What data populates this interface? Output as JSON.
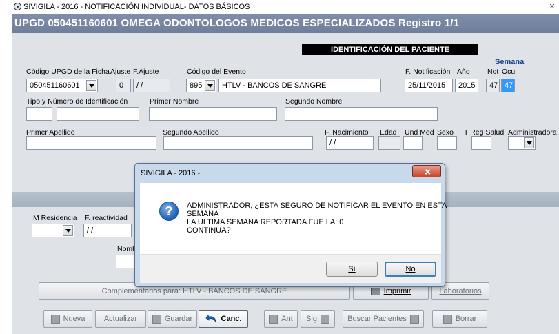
{
  "window": {
    "title": "SIVIGILA - 2016 -  NOTIFICACIÓN INDIVIDUAL- DATOS BÁSICOS",
    "close_label": "✕"
  },
  "header": {
    "upgd_text": "UPGD 050451160601 OMEGA ODONTOLOGOS MEDICOS ESPECIALIZADOS Registro 1/1",
    "section_title": "IDENTIFICACIÓN DEL PACIENTE"
  },
  "form": {
    "codigo_upgd_label": "Código UPGD de la Ficha",
    "codigo_upgd_value": "050451160601",
    "ajuste_label": "Ajuste",
    "ajuste_value": "0",
    "f_ajuste_label": "F.Ajuste",
    "f_ajuste_value": "/ /",
    "codigo_evento_label": "Código del Evento",
    "codigo_evento_value": "895",
    "evento_name": "HTLV - BANCOS DE SANGRE",
    "f_notificacion_label": "F. Notificación",
    "f_notificacion_value": "25/11/2015",
    "anio_label": "Año",
    "anio_value": "2015",
    "semana_label": "Semana",
    "not_label": "Not",
    "ocu_label": "Ocu",
    "semana_not_value": "47",
    "semana_ocu_value": "47",
    "tipo_id_label": "Tipo y Número de Identificación",
    "primer_nombre_label": "Primer Nombre",
    "segundo_nombre_label": "Segundo Nombre",
    "primer_apellido_label": "Primer Apellido",
    "segundo_apellido_label": "Segundo Apellido",
    "f_nacimiento_label": "F. Nacimiento",
    "f_nacimiento_value": "/ /",
    "edad_label": "Edad",
    "und_med_label": "Und Med",
    "sexo_label": "Sexo",
    "t_reg_salud_label": "T Rég Salud",
    "administradora_label": "Administradora",
    "m_residencia_label": "M Residencia",
    "f_reactividad_label": "F. reactividad",
    "f_reactividad_value": "/ /",
    "nombre_partial_label": "Nombr"
  },
  "buttons": {
    "complementarios": "Complementarios para: HTLV - BANCOS DE SANGRE",
    "imprimir": "Imprimir",
    "laboratorios": "Laboratorios",
    "nueva": "Nueva",
    "actualizar": "Actualizar",
    "guardar": "Guardar",
    "canc": "Canc.",
    "ant": "Ant",
    "sig": "Sig",
    "buscar_pacientes": "Buscar Pacientes",
    "borrar": "Borrar"
  },
  "dialog": {
    "title": "SIVIGILA - 2016 -",
    "icon": "question-icon",
    "message_lines": [
      "ADMINISTRADOR, ¿ESTA SEGURO DE NOTIFICAR EL EVENTO EN ESTA",
      "SEMANA",
      "LA ULTIMA SEMANA REPORTADA FUE LA: 0",
      "CONTINUA?"
    ],
    "yes_label": "Sí",
    "no_label": "No"
  },
  "colors": {
    "header_bg": "#7a89a4",
    "form_bg": "#dfe3e8",
    "dialog_frame": "#c9d9ec",
    "selection": "#3399ff",
    "close_red": "#c7442b"
  }
}
